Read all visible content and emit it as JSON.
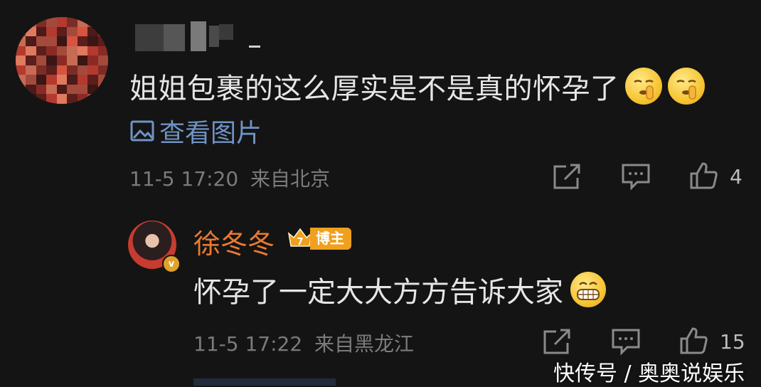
{
  "comment": {
    "text": "姐姐包裹的这么厚实是不是真的怀孕了",
    "emoji": "shush-face-emoji",
    "view_image_label": "查看图片",
    "timestamp": "11-5 17:20",
    "location": "来自北京",
    "like_count": "4"
  },
  "reply": {
    "author": "徐冬冬",
    "badge_label": "博主",
    "badge_level": "7",
    "text": "怀孕了一定大大方方告诉大家",
    "emoji": "grin-emoji",
    "timestamp": "11-5 17:22",
    "location": "来自黑龙江",
    "like_count": "15"
  },
  "icons": {
    "share": "share-icon",
    "comment": "comment-icon",
    "like": "thumbs-up-icon",
    "image": "image-icon"
  },
  "colors": {
    "background": "#141414",
    "link": "#6f93c4",
    "author": "#ea7a32",
    "badge": "#f0a01e"
  },
  "watermark": "快传号 / 奥奥说娱乐"
}
